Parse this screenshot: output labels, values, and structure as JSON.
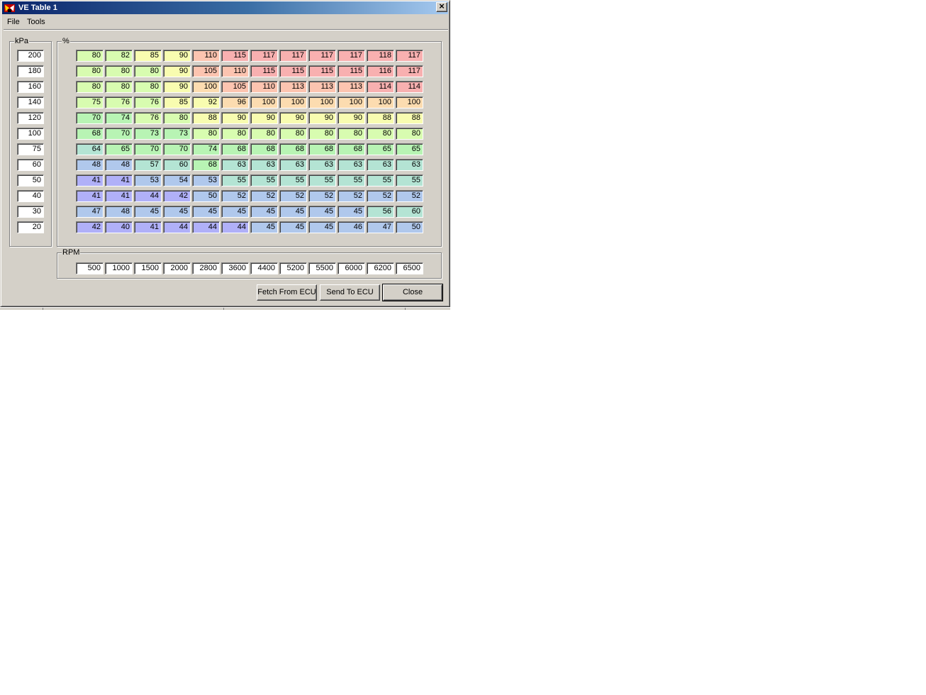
{
  "window": {
    "title": "VE Table 1",
    "menu": [
      "File",
      "Tools"
    ],
    "kpa_label": "kPa",
    "percent_label": "%",
    "rpm_label": "RPM",
    "close_glyph": "×"
  },
  "table": {
    "kpa": [
      "200",
      "180",
      "160",
      "140",
      "120",
      "100",
      "75",
      "60",
      "50",
      "40",
      "30",
      "20"
    ],
    "rpm": [
      "500",
      "1000",
      "1500",
      "2000",
      "2800",
      "3600",
      "4400",
      "5200",
      "5500",
      "6000",
      "6200",
      "6500"
    ],
    "ve": [
      [
        "80",
        "82",
        "85",
        "90",
        "110",
        "115",
        "117",
        "117",
        "117",
        "117",
        "118",
        "117"
      ],
      [
        "80",
        "80",
        "80",
        "90",
        "105",
        "110",
        "115",
        "115",
        "115",
        "115",
        "116",
        "117"
      ],
      [
        "80",
        "80",
        "80",
        "90",
        "100",
        "105",
        "110",
        "113",
        "113",
        "113",
        "114",
        "114"
      ],
      [
        "75",
        "76",
        "76",
        "85",
        "92",
        "96",
        "100",
        "100",
        "100",
        "100",
        "100",
        "100"
      ],
      [
        "70",
        "74",
        "76",
        "80",
        "88",
        "90",
        "90",
        "90",
        "90",
        "90",
        "88",
        "88"
      ],
      [
        "68",
        "70",
        "73",
        "73",
        "80",
        "80",
        "80",
        "80",
        "80",
        "80",
        "80",
        "80"
      ],
      [
        "64",
        "65",
        "70",
        "70",
        "74",
        "68",
        "68",
        "68",
        "68",
        "68",
        "65",
        "65"
      ],
      [
        "48",
        "48",
        "57",
        "60",
        "68",
        "63",
        "63",
        "63",
        "63",
        "63",
        "63",
        "63"
      ],
      [
        "41",
        "41",
        "53",
        "54",
        "53",
        "55",
        "55",
        "55",
        "55",
        "55",
        "55",
        "55"
      ],
      [
        "41",
        "41",
        "44",
        "42",
        "50",
        "52",
        "52",
        "52",
        "52",
        "52",
        "52",
        "52"
      ],
      [
        "47",
        "48",
        "45",
        "45",
        "45",
        "45",
        "45",
        "45",
        "45",
        "45",
        "56",
        "60"
      ],
      [
        "42",
        "40",
        "41",
        "44",
        "44",
        "44",
        "45",
        "45",
        "45",
        "46",
        "47",
        "50"
      ]
    ]
  },
  "buttons": {
    "fetch": "Fetch From ECU",
    "send": "Send To ECU",
    "close": "Close"
  },
  "icons": {
    "app": "app-logo-icon",
    "close": "close-icon"
  },
  "colors": {
    "titlebar_start": "#0a246a",
    "titlebar_end": "#a6caf0",
    "window_face": "#d4d0c8",
    "heat_scale": [
      "#b0b0f8",
      "#b0c8ec",
      "#b4e4d4",
      "#b8f4b4",
      "#d8fcb0",
      "#f8fcb0",
      "#fcdcb0",
      "#fcc4b0",
      "#f8b0b0"
    ]
  }
}
